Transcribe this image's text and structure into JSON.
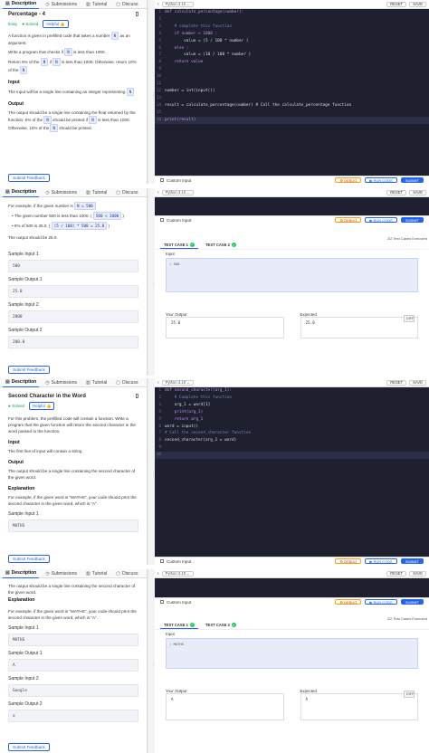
{
  "common": {
    "tabs": [
      "Description",
      "Submissions",
      "Tutorial",
      "Discuss"
    ],
    "lang": "Python 3.10",
    "reset": "RESET",
    "save": "SAVE",
    "custom_input": "Custom Input",
    "debug": "DEBUG",
    "run_code": "RUN CODE",
    "submit": "SUBMIT",
    "feedback": "Submit Feedback",
    "tc1": "TEST CASE 1",
    "tc2": "TEST CASE 2",
    "passed": "2/2 Test Cases Executed",
    "input_label": "Input",
    "your_output": "Your Output",
    "expected": "Expected",
    "diff": "DIFF",
    "sample_input_1": "Sample Input 1",
    "sample_output_1": "Sample Output 1",
    "sample_input_2": "Sample Input 2",
    "sample_output_2": "Sample Output 2"
  },
  "p1": {
    "title": "Percentage - 4",
    "difficulty": "Easy",
    "solved": "Solved",
    "helpful": "Helpful",
    "desc1": "A function is given in prefilled code that takes a number",
    "desc1b": "as an argument.",
    "desc2": "Write a program that checks if",
    "desc2b": "is less than 1000.",
    "desc3": "Return 5% of the",
    "desc3b": "if",
    "desc3c": "is less than 1000. Otherwise, return 10% of the",
    "chip_n": "N",
    "input_head": "Input",
    "input_text": "The input will be a single line containing an integer representing",
    "output_head": "Output",
    "output_text1": "The output should be a single line containing the float returned by the function. 5% of the",
    "output_text2": "should be printed if",
    "output_text3": "is less than",
    "output_text4": "1000. Otherwise, 10% of the",
    "output_text5": "should be printed.",
    "code": [
      "def calculate_percentage(number):",
      "",
      "    # complete this function",
      "    if number < 1000 :",
      "        value = (5 / 100 * number )",
      "    else :",
      "        value = (10 / 100 * number )",
      "    return value",
      "",
      "",
      "",
      "number = int(input())",
      "",
      "result = calculate_percentage(number) # Call the calculate_percentage function",
      "",
      "print(result)"
    ]
  },
  "p2": {
    "ex1": "For example, if the given number is",
    "ex1v": "N = 500",
    "ex2": "The given number 500 is less than 1000. (",
    "ex2v": "500 < 1000",
    "ex3": "5% of 500 is 25.0. (",
    "ex3v": "(5 / 100) * 500 = 25.0",
    "ex4": "The output should be 25.0.",
    "si1": "500",
    "so1": "25.0",
    "si2": "2000",
    "so2": "200.0",
    "tc_input": "500",
    "your_output": "25.0",
    "expected": "25.0"
  },
  "p3": {
    "title": "Second Character in the Word",
    "solved": "Solved",
    "helpful": "Helpful",
    "desc": "For this problem, the prefilled code will contain a function. Write a program that the given function will return the second character in the word passed to the function.",
    "input_head": "Input",
    "input_text": "The first line of input will contain a string.",
    "output_head": "Output",
    "output_text": "The output should be a single line containing the second character of the given word.",
    "explain_head": "Explanation",
    "explain_text": "For example, if the given word is \"MATHS\", your code should print the second character in the given word, which is \"A\".",
    "si1": "MATHS",
    "code": [
      "def second_character(arg_1):",
      "    # Complete this function",
      "    arg_1 = word[1]",
      "    print(arg_1)",
      "    return arg_1",
      "word = input()",
      "# Call the second_character function",
      "second_character(arg_1 = word)",
      "",
      ""
    ]
  },
  "p4": {
    "output_text": "The output should be a single line containing the second character of the given word.",
    "explain_head": "Explanation",
    "explain_text": "For example, if the given word is \"MATHS\", your code should print the second character in the given word, which is \"A\".",
    "si1": "MATHS",
    "so1": "A",
    "si2": "Google",
    "so2": "o",
    "tc_input": "MATHS",
    "your_output": "A",
    "expected": "A"
  }
}
